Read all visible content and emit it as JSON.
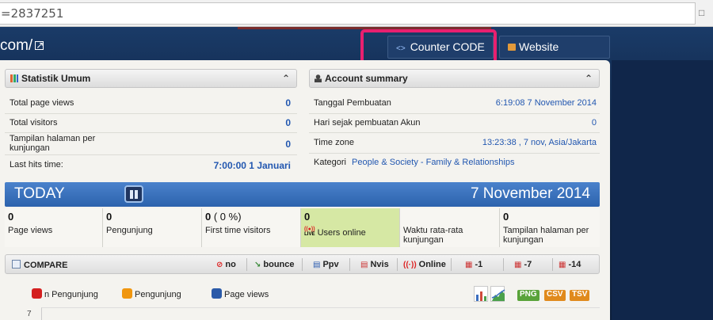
{
  "address_bar": {
    "url": "=2837251"
  },
  "header": {
    "site": "com/",
    "counter_code_label": "Counter CODE",
    "website_account_label": "Website Account"
  },
  "stats": {
    "title": "Statistik Umum",
    "rows": [
      {
        "label": "Total page views",
        "value": "0"
      },
      {
        "label": "Total visitors",
        "value": "0"
      },
      {
        "label": "Tampilan halaman per kunjungan",
        "value": "0"
      },
      {
        "label": "Last hits time:",
        "value": "7:00:00 1 Januari"
      }
    ]
  },
  "account": {
    "title": "Account summary",
    "rows": [
      {
        "label": "Tanggal Pembuatan",
        "value": "6:19:08 7 November 2014"
      },
      {
        "label": "Hari sejak pembuatan Akun",
        "value": "0"
      },
      {
        "label": "Time zone",
        "value": "13:23:38 , 7 nov, Asia/Jakarta"
      },
      {
        "label": "Kategori",
        "value": "People & Society - Family & Relationships"
      }
    ]
  },
  "today": {
    "label": "TODAY",
    "date": "7 November 2014",
    "cells": [
      {
        "num": "0",
        "cap": "Page views"
      },
      {
        "num": "0",
        "cap": "Pengunjung"
      },
      {
        "num": "0",
        "extra": "( 0 %)",
        "cap": "First time visitors"
      },
      {
        "num": "0",
        "cap": "Users online",
        "live": "LIVE"
      },
      {
        "num": "",
        "cap": "Waktu rata-rata kunjungan"
      },
      {
        "num": "0",
        "cap": "Tampilan halaman per kunjungan"
      }
    ]
  },
  "compare": {
    "title": "COMPARE",
    "items": [
      "no",
      "bounce",
      "Ppv",
      "Nvis",
      "Online",
      "-1",
      "-7",
      "-14"
    ]
  },
  "legend": {
    "items": [
      {
        "label": "n Pengunjung",
        "color": "#d42020"
      },
      {
        "label": "Pengunjung",
        "color": "#f0960f"
      },
      {
        "label": "Page views",
        "color": "#2b5aa8"
      }
    ]
  },
  "export": {
    "items": [
      {
        "label": "PNG",
        "color": "#59a33a"
      },
      {
        "label": "CSV",
        "color": "#e08a1d"
      },
      {
        "label": "TSV",
        "color": "#e08a1d"
      }
    ]
  },
  "chart": {
    "y_tick": "7"
  }
}
